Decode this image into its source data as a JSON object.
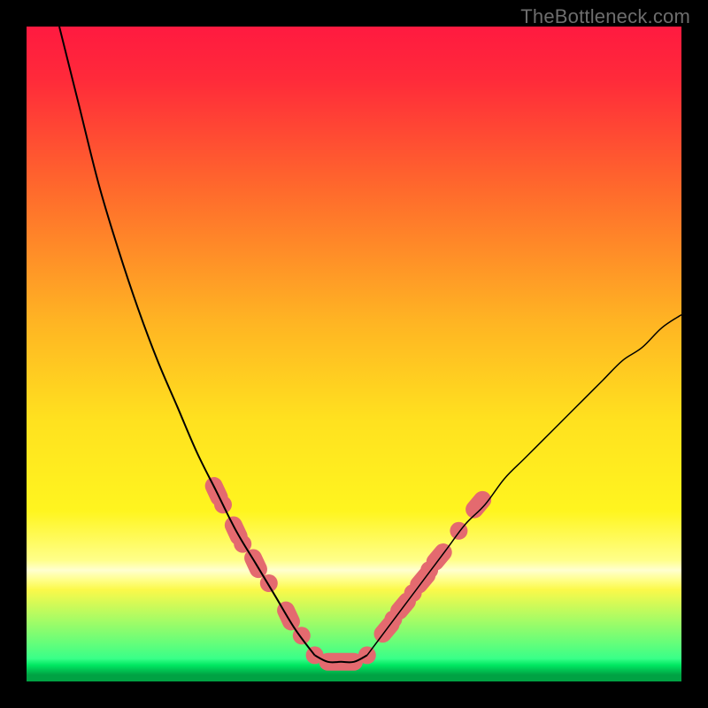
{
  "watermark": "TheBottleneck.com",
  "chart_data": {
    "type": "line",
    "title": "",
    "xlabel": "",
    "ylabel": "",
    "xlim": [
      0,
      100
    ],
    "ylim": [
      0,
      100
    ],
    "grid": false,
    "legend": false,
    "gradient_stops": [
      {
        "offset": 0.0,
        "color": "#ff1a40"
      },
      {
        "offset": 0.08,
        "color": "#ff2a3a"
      },
      {
        "offset": 0.25,
        "color": "#ff6a2c"
      },
      {
        "offset": 0.45,
        "color": "#ffb423"
      },
      {
        "offset": 0.6,
        "color": "#ffe11f"
      },
      {
        "offset": 0.74,
        "color": "#fff51f"
      },
      {
        "offset": 0.815,
        "color": "#ffff8a"
      },
      {
        "offset": 0.83,
        "color": "#ffffd0"
      },
      {
        "offset": 0.845,
        "color": "#ffff8a"
      },
      {
        "offset": 0.86,
        "color": "#fbf94a"
      },
      {
        "offset": 0.965,
        "color": "#39ff88"
      },
      {
        "offset": 0.975,
        "color": "#00e862"
      },
      {
        "offset": 0.99,
        "color": "#00a243"
      },
      {
        "offset": 1.0,
        "color": "#00a243"
      }
    ],
    "series": [
      {
        "name": "left-curve",
        "color": "#000000",
        "width": 2.0,
        "x": [
          5,
          8,
          11,
          14,
          17,
          20,
          23,
          26,
          29,
          32,
          35,
          38,
          41,
          44
        ],
        "values": [
          100,
          88,
          76,
          66,
          57,
          49,
          42,
          35,
          29,
          23,
          18,
          13,
          8,
          4
        ]
      },
      {
        "name": "right-curve",
        "color": "#000000",
        "width": 1.5,
        "x": [
          52,
          55,
          58,
          61,
          64,
          67,
          70,
          73,
          76,
          79,
          82,
          85,
          88,
          91,
          94,
          97,
          100
        ],
        "values": [
          4,
          8,
          12,
          16,
          20,
          24,
          27,
          31,
          34,
          37,
          40,
          43,
          46,
          49,
          51,
          54,
          56
        ]
      },
      {
        "name": "valley-floor",
        "color": "#000000",
        "width": 2.0,
        "x": [
          44,
          46,
          48,
          50,
          52
        ],
        "values": [
          4,
          3,
          3,
          3,
          4
        ]
      }
    ],
    "dots": {
      "left": [
        {
          "x": 29,
          "y": 29
        },
        {
          "x": 30,
          "y": 27
        },
        {
          "x": 32,
          "y": 23
        },
        {
          "x": 33,
          "y": 21
        },
        {
          "x": 35,
          "y": 18
        },
        {
          "x": 37,
          "y": 15
        },
        {
          "x": 40,
          "y": 10
        },
        {
          "x": 42,
          "y": 7
        }
      ],
      "right": [
        {
          "x": 55,
          "y": 8
        },
        {
          "x": 56,
          "y": 9.5
        },
        {
          "x": 57.5,
          "y": 11.5
        },
        {
          "x": 59,
          "y": 13.5
        },
        {
          "x": 60.5,
          "y": 15.5
        },
        {
          "x": 61.5,
          "y": 17
        },
        {
          "x": 63,
          "y": 19
        },
        {
          "x": 66,
          "y": 23
        },
        {
          "x": 69,
          "y": 27
        }
      ],
      "floor": [
        {
          "x": 44,
          "y": 4
        },
        {
          "x": 46,
          "y": 3
        },
        {
          "x": 48,
          "y": 3
        },
        {
          "x": 50,
          "y": 3
        },
        {
          "x": 52,
          "y": 4
        }
      ],
      "color": "#e46a6f",
      "radius": 10
    }
  }
}
